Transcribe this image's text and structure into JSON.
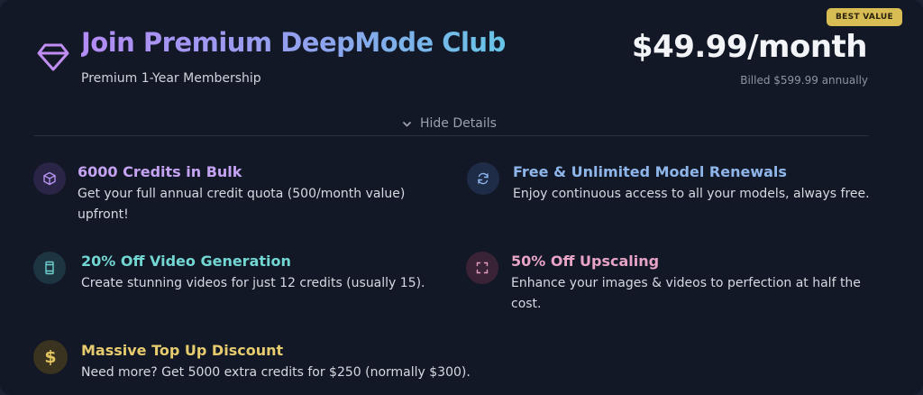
{
  "badge": "BEST VALUE",
  "plan": {
    "title": "Join Premium DeepMode Club",
    "subtitle": "Premium 1-Year Membership",
    "price": "$49.99/month",
    "billed": "Billed $599.99 annually"
  },
  "toggle": {
    "label": "Hide Details",
    "icon": "chevron-down-icon"
  },
  "features": [
    {
      "title": "6000 Credits in Bulk",
      "desc": "Get your full annual credit quota (500/month value) upfront!",
      "icon": "cube-icon",
      "color": "#c5a3f3"
    },
    {
      "title": "Free & Unlimited Model Renewals",
      "desc": "Enjoy continuous access to all your models, always free.",
      "icon": "refresh-icon",
      "color": "#8fb6ea"
    },
    {
      "title": "20% Off Video Generation",
      "desc": "Create stunning videos for just 12 credits (usually 15).",
      "icon": "film-icon",
      "color": "#72d6d2"
    },
    {
      "title": "50% Off Upscaling",
      "desc": "Enhance your images & videos to perfection at half the cost.",
      "icon": "expand-icon",
      "color": "#e7a4c6"
    },
    {
      "title": "Massive Top Up Discount",
      "desc": "Need more? Get 5000 extra credits for $250 (normally $300).",
      "icon": "dollar-icon",
      "glyph": "$",
      "color": "#e6cc6e"
    }
  ]
}
